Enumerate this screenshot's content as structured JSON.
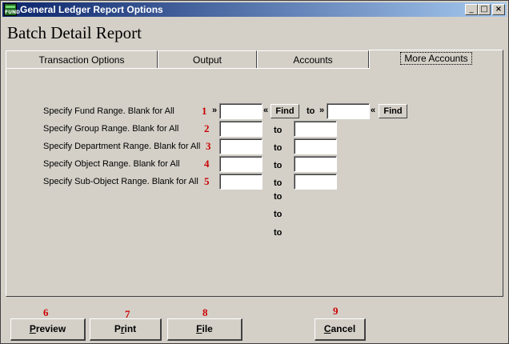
{
  "window": {
    "title": "General Ledger Report Options",
    "icon_text": "FUND"
  },
  "report_title": "Batch Detail Report",
  "tabs": [
    {
      "label": "Transaction Options"
    },
    {
      "label": "Output"
    },
    {
      "label": "Accounts"
    },
    {
      "label": "More Accounts",
      "active": true
    }
  ],
  "ranges": [
    {
      "label": "Specify Fund Range. Blank for All",
      "num": "1",
      "from": "",
      "to": ""
    },
    {
      "label": "Specify Group Range. Blank for All",
      "num": "2",
      "from": "",
      "to": ""
    },
    {
      "label": "Specify Department Range. Blank for All",
      "num": "3",
      "from": "",
      "to": ""
    },
    {
      "label": "Specify Object Range. Blank for All",
      "num": "4",
      "from": "",
      "to": ""
    },
    {
      "label": "Specify Sub-Object Range. Blank for All",
      "num": "5",
      "from": "",
      "to": ""
    }
  ],
  "to_label": "to",
  "find_label": "Find",
  "chev_right": "»",
  "chev_left": "«",
  "buttons": {
    "preview": {
      "label_first": "P",
      "label_rest": "review",
      "num": "6"
    },
    "print": {
      "label_first": "P",
      "label_mid": "r",
      "label_rest": "int",
      "num": "7"
    },
    "file": {
      "label_first": "F",
      "label_rest": "ile",
      "num": "8"
    },
    "cancel": {
      "label_first": "C",
      "label_rest": "ancel",
      "num": "9"
    }
  }
}
